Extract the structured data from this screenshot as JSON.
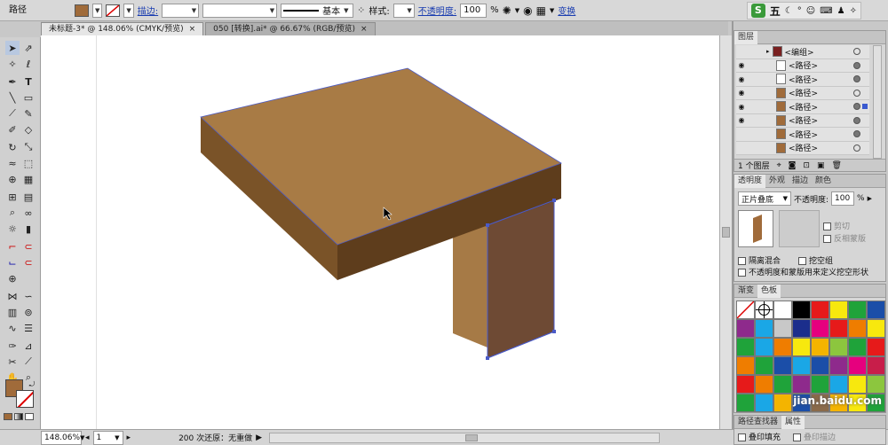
{
  "control_bar": {
    "object_type": "路径",
    "stroke_label": "描边:",
    "stroke_profile": "基本",
    "style_label": "样式:",
    "opacity_label": "不透明度:",
    "opacity_value": "100",
    "opacity_unit": "%",
    "transform_label": "变换",
    "fill_color": "#a06b3a"
  },
  "ime": {
    "logo": "S",
    "mode": "五"
  },
  "tabs": [
    {
      "label": "未标题-3* @ 148.06% (CMYK/预览)",
      "close": "×"
    },
    {
      "label": "050 [转换].ai* @ 66.67% (RGB/预览)",
      "close": "×"
    }
  ],
  "status": {
    "zoom": "148.06%",
    "page": "1",
    "undo": "200 次还原：无重做"
  },
  "layers_panel": {
    "title": "图层",
    "rows": [
      {
        "name": "<编组>",
        "visible": false
      },
      {
        "name": "<路径>",
        "visible": true
      },
      {
        "name": "<路径>",
        "visible": true
      },
      {
        "name": "<路径>",
        "visible": true
      },
      {
        "name": "<路径>",
        "visible": true
      },
      {
        "name": "<路径>",
        "visible": true
      },
      {
        "name": "<路径>",
        "visible": false
      },
      {
        "name": "<路径>",
        "visible": false
      }
    ],
    "footer": "1 个图层"
  },
  "transparency_panel": {
    "tabs": [
      "透明度",
      "外观",
      "描边",
      "颜色"
    ],
    "blend_mode": "正片叠底",
    "opacity_label": "不透明度:",
    "opacity_value": "100",
    "opacity_unit": "%",
    "clip_label": "剪切",
    "invert_mask_label": "反相蒙版",
    "isolate_blend_label": "隔离混合",
    "knockout_label": "挖空组",
    "opacity_mask_label": "不透明度和蒙版用来定义挖空形状"
  },
  "swatches_panel": {
    "tabs": [
      "渐变",
      "色板"
    ],
    "colors": [
      "#ffffff",
      "#ffffff",
      "#ffffff",
      "#000000",
      "#e61a1a",
      "#f7e80e",
      "#1fa33a",
      "#1b4ea8",
      "#8e2a8c",
      "#1aa7e6",
      "#c8c8c8",
      "#1b2e8c",
      "#e6007e",
      "#e61a1a",
      "#ef7d00",
      "#f7e80e",
      "#1fa33a",
      "#1aa7e6",
      "#ef7d00",
      "#f7e80e",
      "#f4b400",
      "#8cc63e",
      "#1fa33a",
      "#e61a1a",
      "#ef7d00",
      "#1fa33a",
      "#1b4ea8",
      "#1aa7e6",
      "#1b4ea8",
      "#8e2a8c",
      "#e6007e",
      "#c81e4a",
      "#e61a1a",
      "#ef7d00",
      "#1fa33a",
      "#8e2a8c",
      "#1fa33a",
      "#1aa7e6",
      "#f7e80e",
      "#8cc63e",
      "#1fa33a",
      "#1aa7e6",
      "#f4b400",
      "#1b4ea8",
      "#8a6a4a",
      "#f4b400",
      "#f7e80e",
      "#1fa33a",
      "#1aa7e6",
      "#1b4ea8",
      "#e61a1a",
      "#ef7d00",
      "#1fa33a",
      "#6a4a2a"
    ]
  },
  "bottom_panel": {
    "tabs": [
      "路径查找器",
      "属性"
    ],
    "overprint_fill": "叠印填充",
    "overprint_stroke": "叠印描边"
  },
  "watermark": "jian.baidu.com",
  "artwork": {
    "top_color": "#a87b45",
    "front_color": "#6b4a24",
    "side_color": "#5e3d1c",
    "leg_left": "#a67a46",
    "leg_right": "#6e4a34"
  }
}
